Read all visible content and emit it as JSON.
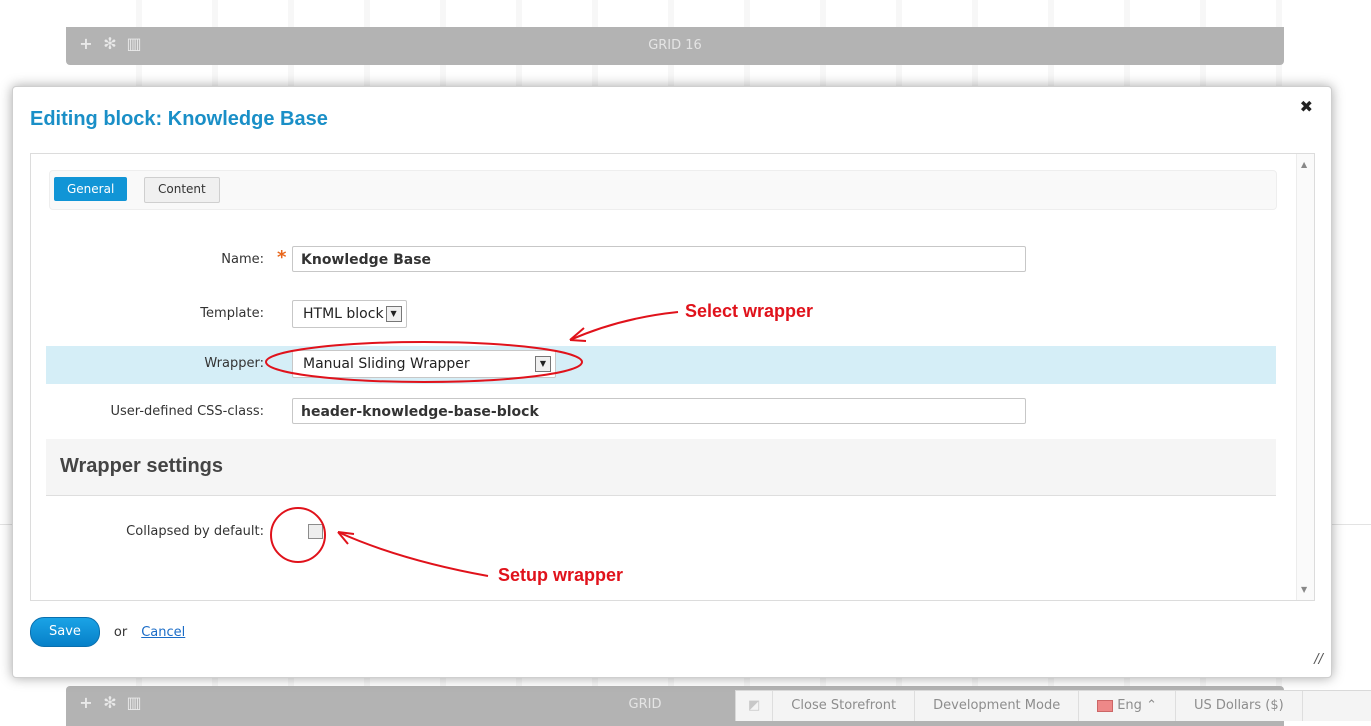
{
  "background": {
    "grid_bar_top_title": "GRID 16",
    "grid_bar_bottom_title": "GRID"
  },
  "dialog": {
    "title": "Editing block: Knowledge Base",
    "close_icon": "✖",
    "tabs": [
      {
        "label": "General",
        "active": true
      },
      {
        "label": "Content",
        "active": false
      }
    ],
    "fields": {
      "name": {
        "label": "Name:",
        "value": "Knowledge Base",
        "required": true
      },
      "template": {
        "label": "Template:",
        "value": "HTML block"
      },
      "wrapper": {
        "label": "Wrapper:",
        "value": "Manual Sliding Wrapper"
      },
      "css_class": {
        "label": "User-defined CSS-class:",
        "value": "header-knowledge-base-block"
      }
    },
    "section_heading": "Wrapper settings",
    "collapsed": {
      "label": "Collapsed by default:",
      "checked": false
    },
    "footer": {
      "save_label": "Save",
      "or_text": "or",
      "cancel_label": "Cancel"
    }
  },
  "annotations": {
    "select_wrapper": "Select wrapper",
    "setup_wrapper": "Setup wrapper",
    "color": "#e0121b"
  },
  "statusbar": {
    "items": [
      "Close Storefront",
      "Development Mode",
      "Eng",
      "US Dollars ($)"
    ]
  },
  "colors": {
    "accent": "#1a8fc7",
    "tab_active": "#1195d6",
    "highlight_row": "#d5eef7",
    "required": "#e8661b"
  }
}
